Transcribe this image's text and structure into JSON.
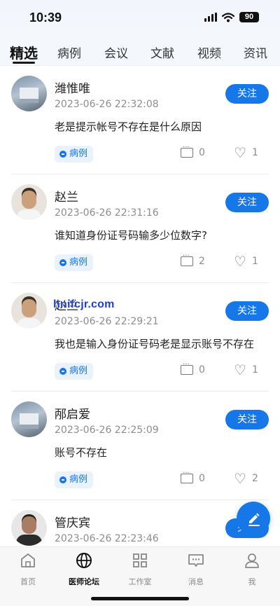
{
  "status_bar": {
    "time": "10:39",
    "battery": "90"
  },
  "tabs": [
    {
      "label": "精选",
      "active": true
    },
    {
      "label": "病例",
      "active": false
    },
    {
      "label": "会议",
      "active": false
    },
    {
      "label": "文献",
      "active": false
    },
    {
      "label": "视频",
      "active": false
    },
    {
      "label": "资讯",
      "active": false
    }
  ],
  "posts": [
    {
      "author": "潍惟唯",
      "time": "2023-06-26 22:32:08",
      "content": "老是提示帐号不存在是什么原因",
      "tag": "病例",
      "comments": "0",
      "likes": "1",
      "follow_label": "关注",
      "avatar": "building-avatar"
    },
    {
      "author": "赵兰",
      "time": "2023-06-26 22:31:16",
      "content": "谁知道身份证号码输多少位数字?",
      "tag": "病例",
      "comments": "2",
      "likes": "1",
      "follow_label": "关注",
      "avatar": "person-avatar"
    },
    {
      "author": "赵兰",
      "time": "2023-06-26 22:29:21",
      "content": "我也是输入身份证号码老是显示账号不存在",
      "tag": "病例",
      "comments": "0",
      "likes": "1",
      "follow_label": "关注",
      "avatar": "person-avatar"
    },
    {
      "author": "邴启爱",
      "time": "2023-06-26 22:25:09",
      "content": "账号不存在",
      "tag": "病例",
      "comments": "0",
      "likes": "2",
      "follow_label": "关注",
      "avatar": "building-avatar"
    },
    {
      "author": "管庆宾",
      "time": "2023-06-26 22:23:46",
      "content": "",
      "tag": "",
      "comments": "",
      "likes": "",
      "follow_label": "关注",
      "avatar": "man-avatar"
    }
  ],
  "watermark": "hnifcjr.com",
  "bottom_nav": [
    {
      "label": "首页",
      "icon": "home-icon",
      "active": false
    },
    {
      "label": "医师论坛",
      "icon": "globe-icon",
      "active": true
    },
    {
      "label": "工作室",
      "icon": "grid-icon",
      "active": false
    },
    {
      "label": "消息",
      "icon": "message-icon",
      "active": false
    },
    {
      "label": "我",
      "icon": "user-icon",
      "active": false
    }
  ],
  "colors": {
    "accent": "#1677e8",
    "tag_bg": "#eaf3fd",
    "tab_bar_bg": "#f4f7fc"
  }
}
